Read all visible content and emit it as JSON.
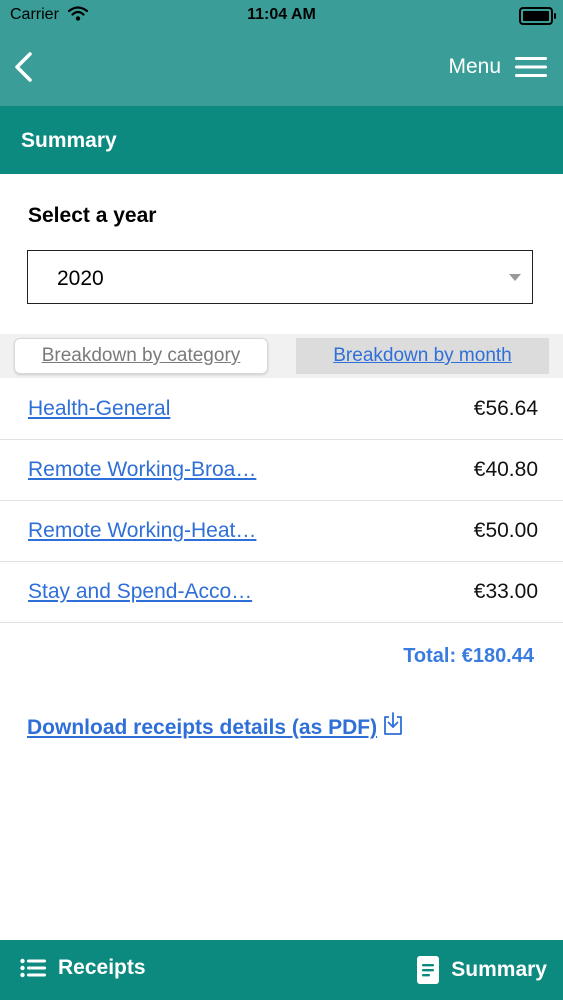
{
  "status_bar": {
    "carrier": "Carrier",
    "time": "11:04 AM"
  },
  "nav": {
    "menu_label": "Menu",
    "back_icon": "chevron-left-icon",
    "menu_icon": "hamburger-icon"
  },
  "header": {
    "title": "Summary"
  },
  "year_select": {
    "label": "Select a year",
    "value": "2020"
  },
  "tabs": {
    "category": "Breakdown by category",
    "month": "Breakdown by month",
    "active": "category"
  },
  "items": [
    {
      "name": "Health-General",
      "amount": "€56.64"
    },
    {
      "name": "Remote Working-Broa…",
      "amount": "€40.80"
    },
    {
      "name": "Remote Working-Heat…",
      "amount": "€50.00"
    },
    {
      "name": "Stay and Spend-Acco…",
      "amount": "€33.00"
    }
  ],
  "total": "Total: €180.44",
  "download": {
    "label": "Download receipts details (as PDF)",
    "icon": "download-icon"
  },
  "bottom_tabs": {
    "receipts": "Receipts",
    "summary": "Summary"
  },
  "colors": {
    "nav": "#3a9d98",
    "header": "#0d8a80",
    "link": "#2f6fd8",
    "total": "#3a7be0"
  }
}
